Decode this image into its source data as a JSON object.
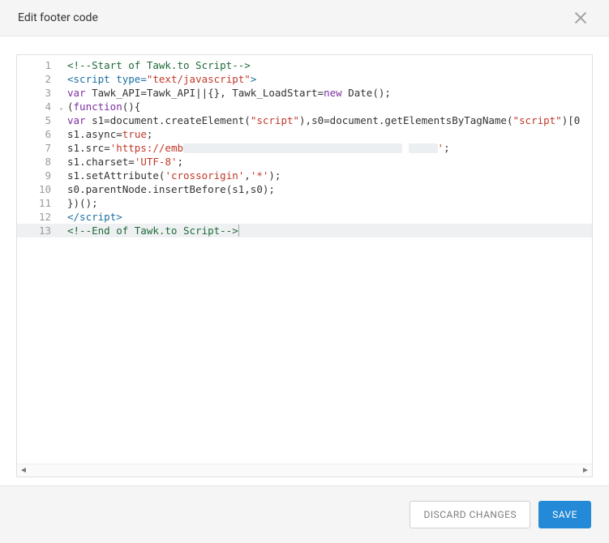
{
  "header": {
    "title": "Edit footer code"
  },
  "buttons": {
    "discard": "DISCARD CHANGES",
    "save": "SAVE"
  },
  "editor": {
    "active_line": 13,
    "fold_line": 4,
    "lines": [
      {
        "n": 1,
        "tokens": [
          {
            "t": "<!--Start of Tawk.to Script-->",
            "c": "c-comment"
          }
        ]
      },
      {
        "n": 2,
        "tokens": [
          {
            "t": "<script ",
            "c": "c-tag"
          },
          {
            "t": "type",
            "c": "c-attr"
          },
          {
            "t": "=",
            "c": "c-tag"
          },
          {
            "t": "\"text/javascript\"",
            "c": "c-str"
          },
          {
            "t": ">",
            "c": "c-tag"
          }
        ]
      },
      {
        "n": 3,
        "tokens": [
          {
            "t": "var",
            "c": "c-kw"
          },
          {
            "t": " Tawk_API",
            "c": ""
          },
          {
            "t": "=",
            "c": ""
          },
          {
            "t": "Tawk_API",
            "c": ""
          },
          {
            "t": "||{}, ",
            "c": ""
          },
          {
            "t": "Tawk_LoadStart",
            "c": ""
          },
          {
            "t": "=",
            "c": ""
          },
          {
            "t": "new",
            "c": "c-kw"
          },
          {
            "t": " ",
            "c": ""
          },
          {
            "t": "Date",
            "c": "c-fn"
          },
          {
            "t": "();",
            "c": ""
          }
        ]
      },
      {
        "n": 4,
        "tokens": [
          {
            "t": "(",
            "c": ""
          },
          {
            "t": "function",
            "c": "c-kw"
          },
          {
            "t": "(){",
            "c": ""
          }
        ]
      },
      {
        "n": 5,
        "tokens": [
          {
            "t": "var",
            "c": "c-kw"
          },
          {
            "t": " s1",
            "c": ""
          },
          {
            "t": "=",
            "c": ""
          },
          {
            "t": "document",
            "c": "c-fn"
          },
          {
            "t": ".",
            "c": ""
          },
          {
            "t": "createElement",
            "c": "c-fn"
          },
          {
            "t": "(",
            "c": ""
          },
          {
            "t": "\"script\"",
            "c": "c-str"
          },
          {
            "t": "),s0",
            "c": ""
          },
          {
            "t": "=",
            "c": ""
          },
          {
            "t": "document",
            "c": "c-fn"
          },
          {
            "t": ".",
            "c": ""
          },
          {
            "t": "getElementsByTagName",
            "c": "c-fn"
          },
          {
            "t": "(",
            "c": ""
          },
          {
            "t": "\"script\"",
            "c": "c-str"
          },
          {
            "t": ")[0",
            "c": ""
          }
        ]
      },
      {
        "n": 6,
        "tokens": [
          {
            "t": "s1",
            "c": ""
          },
          {
            "t": ".",
            "c": ""
          },
          {
            "t": "async",
            "c": "c-fn"
          },
          {
            "t": "=",
            "c": ""
          },
          {
            "t": "true",
            "c": "c-bool"
          },
          {
            "t": ";",
            "c": ""
          }
        ]
      },
      {
        "n": 7,
        "tokens": [
          {
            "t": "s1",
            "c": ""
          },
          {
            "t": ".",
            "c": ""
          },
          {
            "t": "src",
            "c": "c-fn"
          },
          {
            "t": "=",
            "c": ""
          },
          {
            "t": "'https://emb",
            "c": "c-str"
          },
          {
            "redact": 270
          },
          {
            "t": " ",
            "c": ""
          },
          {
            "redact": 36
          },
          {
            "t": "'",
            "c": "c-str"
          },
          {
            "t": ";",
            "c": ""
          }
        ]
      },
      {
        "n": 8,
        "tokens": [
          {
            "t": "s1",
            "c": ""
          },
          {
            "t": ".",
            "c": ""
          },
          {
            "t": "charset",
            "c": "c-fn"
          },
          {
            "t": "=",
            "c": ""
          },
          {
            "t": "'UTF-8'",
            "c": "c-str"
          },
          {
            "t": ";",
            "c": ""
          }
        ]
      },
      {
        "n": 9,
        "tokens": [
          {
            "t": "s1",
            "c": ""
          },
          {
            "t": ".",
            "c": ""
          },
          {
            "t": "setAttribute",
            "c": "c-fn"
          },
          {
            "t": "(",
            "c": ""
          },
          {
            "t": "'crossorigin'",
            "c": "c-str"
          },
          {
            "t": ",",
            "c": ""
          },
          {
            "t": "'*'",
            "c": "c-str"
          },
          {
            "t": ");",
            "c": ""
          }
        ]
      },
      {
        "n": 10,
        "tokens": [
          {
            "t": "s0",
            "c": ""
          },
          {
            "t": ".",
            "c": ""
          },
          {
            "t": "parentNode",
            "c": "c-fn"
          },
          {
            "t": ".",
            "c": ""
          },
          {
            "t": "insertBefore",
            "c": "c-fn"
          },
          {
            "t": "(s1,s0);",
            "c": ""
          }
        ]
      },
      {
        "n": 11,
        "tokens": [
          {
            "t": "})();",
            "c": ""
          }
        ]
      },
      {
        "n": 12,
        "tokens": [
          {
            "t": "</scr",
            "c": "c-tag"
          },
          {
            "t": "ipt>",
            "c": "c-tag"
          }
        ]
      },
      {
        "n": 13,
        "tokens": [
          {
            "t": "<!--End of Tawk.to Script-->",
            "c": "c-comment"
          }
        ],
        "cursor_after": true
      }
    ]
  }
}
